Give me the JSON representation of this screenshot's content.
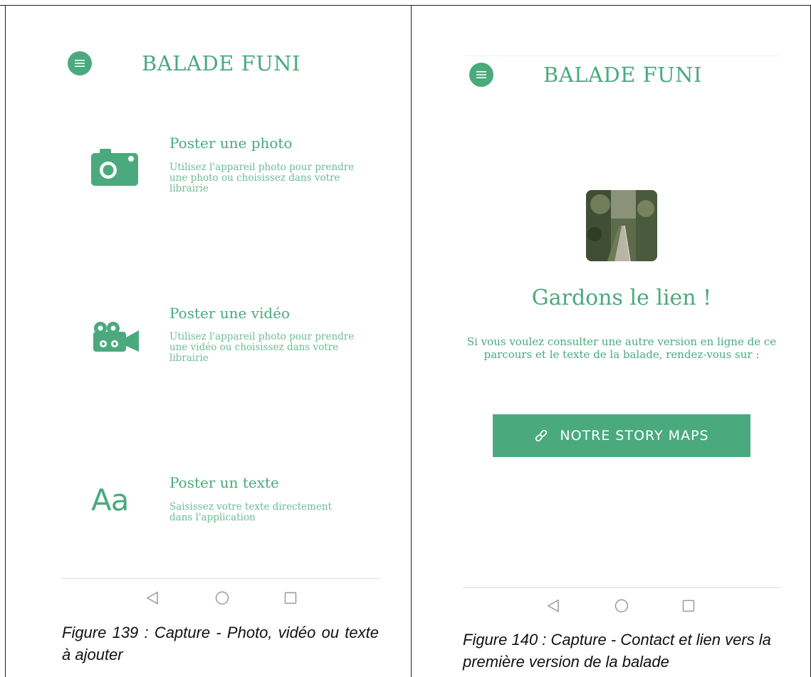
{
  "left_screen": {
    "title": "BALADE FUNI",
    "options": [
      {
        "icon": "camera-icon",
        "title": "Poster une photo",
        "description": "Utilisez l'appareil photo pour prendre une photo ou choisissez dans votre librairie"
      },
      {
        "icon": "video-camera-icon",
        "title": "Poster une vidéo",
        "description": "Utilisez l'appareil photo pour prendre une vidéo ou choisissez dans votre librairie"
      },
      {
        "icon": "text-aa-icon",
        "icon_text": "Aa",
        "title": "Poster un texte",
        "description": "Saisissez votre texte directement dans l'application"
      }
    ],
    "caption": "Figure 139 : Capture - Photo, vidéo ou texte à ajouter"
  },
  "right_screen": {
    "title": "BALADE FUNI",
    "headline": "Gardons le lien !",
    "body": "Si vous voulez consulter une autre version en ligne de ce parcours et le texte de la balade, rendez-vous sur :",
    "cta_label": "NOTRE STORY MAPS",
    "cta_icon": "link-icon",
    "caption": "Figure 140 : Capture - Contact et lien vers la première version de la balade"
  },
  "colors": {
    "accent": "#4aaa7e",
    "caption_text": "#111111",
    "nav_icon": "#9a9a9a"
  }
}
